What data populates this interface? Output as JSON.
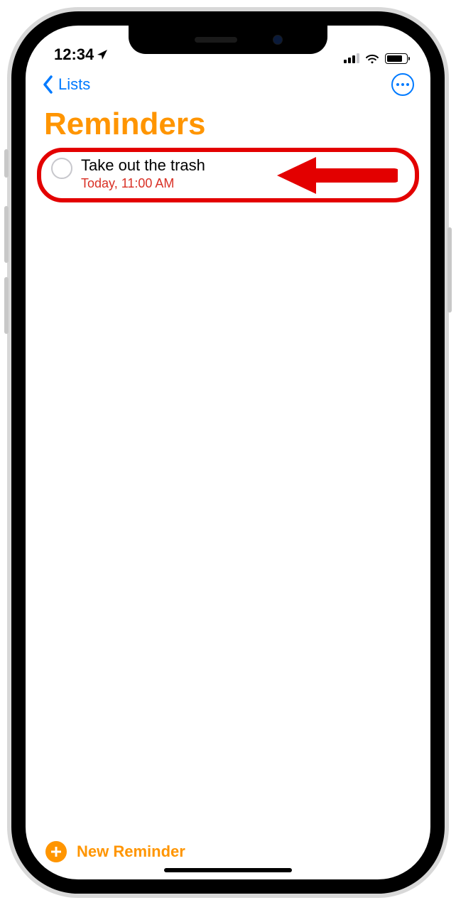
{
  "status": {
    "time": "12:34"
  },
  "nav": {
    "back_label": "Lists"
  },
  "page_title": "Reminders",
  "reminders": [
    {
      "title": "Take out the trash",
      "due": "Today, 11:00 AM"
    }
  ],
  "footer": {
    "new_reminder_label": "New Reminder"
  }
}
